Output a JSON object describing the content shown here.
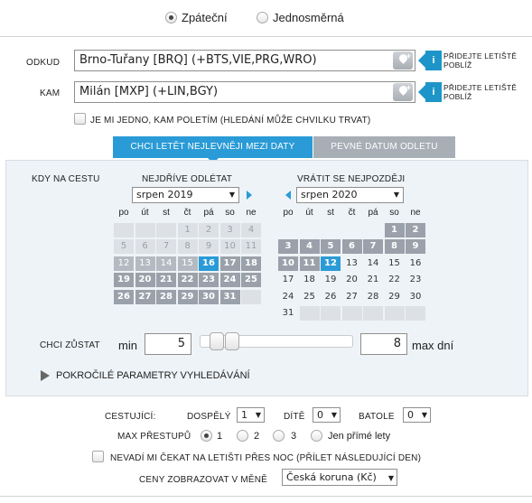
{
  "trip_type": {
    "return_label": "Zpáteční",
    "oneway_label": "Jednosměrná",
    "selected": "return"
  },
  "from": {
    "label": "ODKUD",
    "value": "Brno-Tuřany [BRQ] (+BTS,VIE,PRG,WRO)",
    "map_icon": "map-pin-add-icon",
    "nearby_line1": "PŘIDEJTE LETIŠTĚ",
    "nearby_line2": "POBLÍŽ"
  },
  "to": {
    "label": "KAM",
    "value": "Milán [MXP] (+LIN,BGY)",
    "map_icon": "map-pin-add-icon",
    "nearby_line1": "PŘIDEJTE LETIŠTĚ",
    "nearby_line2": "POBLÍŽ"
  },
  "anywhere_checkbox": {
    "label": "JE MI JEDNO, KAM POLETÍM (HLEDÁNÍ MŮŽE CHVILKU TRVAT)",
    "checked": false
  },
  "tabs": [
    {
      "label": "CHCI LETĚT NEJLEVNĚJI MEZI DATY",
      "active": true
    },
    {
      "label": "PEVNÉ DATUM ODLETU",
      "active": false
    }
  ],
  "dates": {
    "when_label": "KDY NA CESTU",
    "depart": {
      "title": "NEJDŘÍVE ODLÉTAT",
      "month": "srpen 2019"
    },
    "return": {
      "title": "VRÁTIT SE NEJPOZDĚJI",
      "month": "srpen 2020"
    },
    "weekdays": [
      "po",
      "út",
      "st",
      "čt",
      "pá",
      "so",
      "ne"
    ],
    "depart_days": [
      [
        "",
        "",
        "",
        "1",
        "2",
        "3",
        "4"
      ],
      [
        "5",
        "6",
        "7",
        "8",
        "9",
        "10",
        "11"
      ],
      [
        "12",
        "13",
        "14",
        "15",
        "16",
        "17",
        "18"
      ],
      [
        "19",
        "20",
        "21",
        "22",
        "23",
        "24",
        "25"
      ],
      [
        "26",
        "27",
        "28",
        "29",
        "30",
        "31",
        ""
      ]
    ],
    "return_days": [
      [
        "",
        "",
        "",
        "",
        "",
        "1",
        "2"
      ],
      [
        "3",
        "4",
        "5",
        "6",
        "7",
        "8",
        "9"
      ],
      [
        "10",
        "11",
        "12",
        "13",
        "14",
        "15",
        "16"
      ],
      [
        "17",
        "18",
        "19",
        "20",
        "21",
        "22",
        "23"
      ],
      [
        "24",
        "25",
        "26",
        "27",
        "28",
        "29",
        "30"
      ],
      [
        "31",
        "",
        "",
        "",
        "",
        "",
        ""
      ]
    ],
    "depart_selected_day": "16",
    "return_selected_day": "12"
  },
  "stay": {
    "label": "CHCI ZŮSTAT",
    "min_label": "min",
    "min_value": "5",
    "max_value": "8",
    "max_label": "max dní"
  },
  "advanced": {
    "label": "POKROČILÉ PARAMETRY VYHLEDÁVÁNÍ"
  },
  "passengers": {
    "label": "CESTUJÍCÍ:",
    "adult_label": "DOSPĚLÝ",
    "adult_value": "1",
    "child_label": "DÍTĚ",
    "child_value": "0",
    "infant_label": "BATOLE",
    "infant_value": "0"
  },
  "stops": {
    "label": "MAX PŘESTUPŮ",
    "options": [
      "1",
      "2",
      "3",
      "Jen přímé lety"
    ],
    "selected": "1"
  },
  "overnight_checkbox": {
    "label": "NEVADÍ MI ČEKAT NA LETIŠTI PŘES NOC (PŘÍLET NÁSLEDUJÍCÍ DEN)",
    "checked": false
  },
  "currency": {
    "label": "CENY ZOBRAZOVAT V MĚNĚ",
    "value": "Česká koruna (Kč)"
  },
  "colors": {
    "accent": "#2a9bd6",
    "range_day": "#9ba1aa",
    "tab_inactive": "#a7aeb6",
    "info_tag": "#1d95c9"
  }
}
